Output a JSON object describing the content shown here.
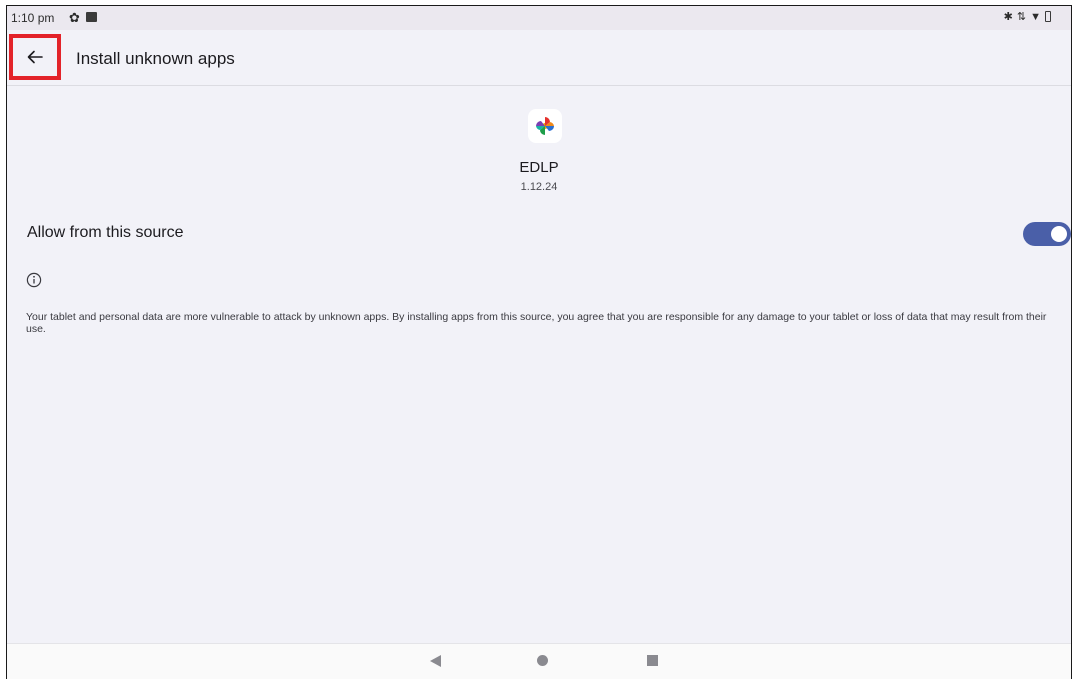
{
  "status_bar": {
    "time": "1:10 pm",
    "icons": [
      "gear-icon",
      "photo-icon",
      "bluetooth-icon",
      "data-arrows-icon",
      "wifi-icon",
      "battery-icon"
    ]
  },
  "app_bar": {
    "back_icon": "arrow-back-icon",
    "title": "Install unknown apps",
    "highlight_color": "#e3232a"
  },
  "app_info": {
    "name": "EDLP",
    "version": "1.12.24",
    "icon": "pinwheel-app-icon"
  },
  "setting": {
    "label": "Allow from this source",
    "enabled": true,
    "accent_color": "#4a5fa8"
  },
  "info": {
    "icon": "info-icon",
    "text": "Your tablet and personal data are more vulnerable to attack by unknown apps. By installing apps from this source, you agree that you are responsible for any damage to your tablet or loss of data that may result from their use."
  },
  "nav_bar": {
    "buttons": [
      "nav-back-icon",
      "nav-home-icon",
      "nav-recents-icon"
    ]
  }
}
